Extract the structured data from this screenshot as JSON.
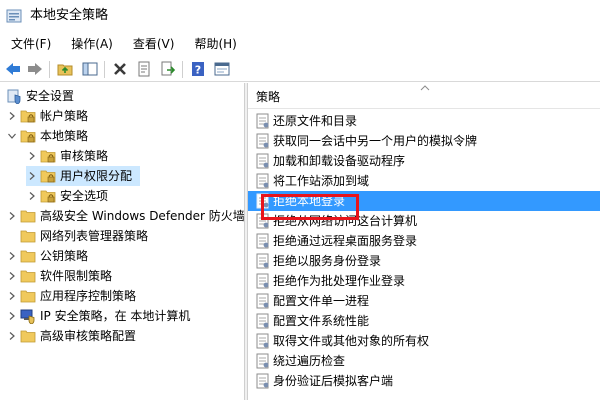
{
  "window": {
    "title": "本地安全策略"
  },
  "menu": [
    {
      "label": "文件(F)"
    },
    {
      "label": "操作(A)"
    },
    {
      "label": "查看(V)"
    },
    {
      "label": "帮助(H)"
    }
  ],
  "toolbar": [
    "back-icon",
    "forward-icon",
    "up-folder-icon",
    "show-hide-tree-icon",
    "delete-icon",
    "properties-icon",
    "export-list-icon",
    "help-icon",
    "help-topics-icon"
  ],
  "tree": {
    "root": "安全设置",
    "items": [
      {
        "label": "帐户策略",
        "expanded": false
      },
      {
        "label": "本地策略",
        "expanded": true
      },
      {
        "label": "审核策略"
      },
      {
        "label": "用户权限分配",
        "selected": true
      },
      {
        "label": "安全选项"
      },
      {
        "label": "高级安全 Windows Defender 防火墙"
      },
      {
        "label": "网络列表管理器策略"
      },
      {
        "label": "公钥策略"
      },
      {
        "label": "软件限制策略"
      },
      {
        "label": "应用程序控制策略"
      },
      {
        "label": "IP 安全策略，在 本地计算机"
      },
      {
        "label": "高级审核策略配置"
      }
    ]
  },
  "list": {
    "column_header": "策略",
    "items": [
      {
        "label": "还原文件和目录"
      },
      {
        "label": "获取同一会话中另一个用户的模拟令牌"
      },
      {
        "label": "加载和卸载设备驱动程序"
      },
      {
        "label": "将工作站添加到域"
      },
      {
        "label": "拒绝本地登录",
        "selected": true
      },
      {
        "label": "拒绝从网络访问这台计算机"
      },
      {
        "label": "拒绝通过远程桌面服务登录"
      },
      {
        "label": "拒绝以服务身份登录"
      },
      {
        "label": "拒绝作为批处理作业登录"
      },
      {
        "label": "配置文件单一进程"
      },
      {
        "label": "配置文件系统性能"
      },
      {
        "label": "取得文件或其他对象的所有权"
      },
      {
        "label": "绕过遍历检查"
      },
      {
        "label": "身份验证后模拟客户端"
      }
    ]
  },
  "colors": {
    "selection": "#3399ff",
    "tree_selection": "#cce8ff",
    "highlight_box": "#e8141b"
  }
}
